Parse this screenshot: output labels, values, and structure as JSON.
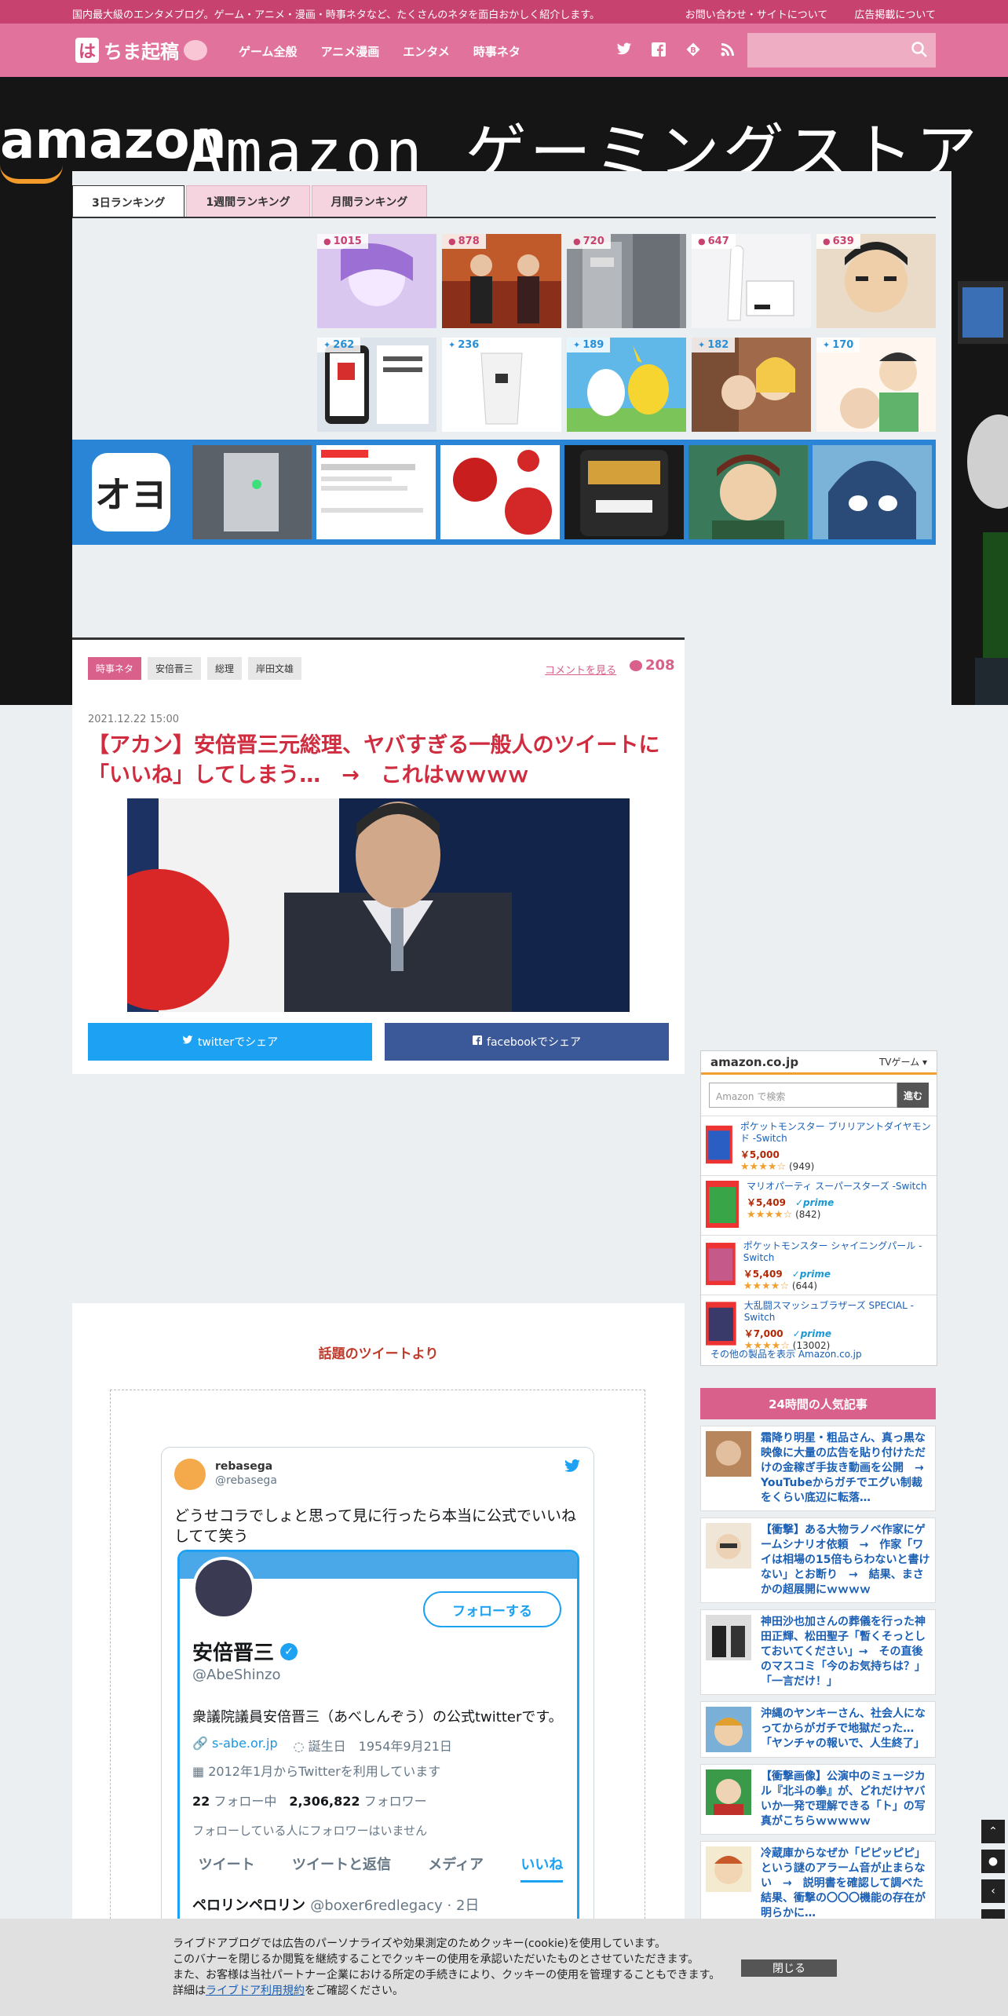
{
  "topbar": {
    "tagline": "国内最大級のエンタメブログ。ゲーム・アニメ・漫画・時事ネタなど、たくさんのネタを面白おかしく紹介します。",
    "contact": "お問い合わせ・サイトについて",
    "ads": "広告掲載について"
  },
  "header": {
    "logo_mark": "は",
    "logo_text": "ちま起稿",
    "menu": [
      "ゲーム全般",
      "アニメ漫画",
      "エンタメ",
      "時事ネタ"
    ]
  },
  "banner": {
    "brand": "amazon",
    "headline": "Amazon ゲーミングストア"
  },
  "ranking": {
    "tabs": [
      "3日ランキング",
      "1週間ランキング",
      "月間ランキング"
    ],
    "comment_counts": [
      "1015",
      "878",
      "720",
      "647",
      "639"
    ],
    "tweet_counts": [
      "262",
      "236",
      "189",
      "182",
      "170"
    ],
    "okuyomu_logo": "オヨ"
  },
  "article": {
    "tags": [
      "時事ネタ",
      "安倍晋三",
      "総理",
      "岸田文雄"
    ],
    "comment_link": "コメントを見る",
    "comment_count": "208",
    "date": "2021.12.22 15:00",
    "title": "【アカン】安倍晋三元総理、ヤバすぎる一般人のツイートに「いいね」してしまう…　→　これはｗｗｗｗ",
    "share_twitter": "twitterでシェア",
    "share_facebook": "facebookでシェア"
  },
  "feature": {
    "heading": "話題のツイートより",
    "tweet": {
      "user": "rebasega",
      "handle": "@rebasega",
      "text": "どうせコラでしょと思って見に行ったら本当に公式でいいねしてて笑う"
    },
    "profile": {
      "follow": "フォローする",
      "name": "安倍晋三",
      "handle": "@AbeShinzo",
      "bio": "衆議院議員安倍晋三（あべしんぞう）の公式twitterです。",
      "link": "s-abe.or.jp",
      "birthday": "誕生日　1954年9月21日",
      "joined": "2012年1月からTwitterを利用しています",
      "following_num": "22",
      "following_label": "フォロー中",
      "followers_num": "2,306,822",
      "followers_label": "フォロワー",
      "no_mutual": "フォローしている人にフォロワーはいません",
      "tabs": [
        "ツイート",
        "ツイートと返信",
        "メディア",
        "いいね"
      ],
      "reply_name": "ペロリンペロリン",
      "reply_handle": "@boxer6redlegacy · 2日"
    }
  },
  "amazon_widget": {
    "logo": "amazon.co.jp",
    "category": "TVゲーム",
    "search_placeholder": "Amazon で検索",
    "search_button": "進む",
    "items": [
      {
        "name": "ポケットモンスター ブリリアントダイヤモンド -Switch",
        "price": "￥5,000",
        "stars": "★★★★☆",
        "reviews": "(949)",
        "prime": ""
      },
      {
        "name": "マリオパーティ スーパースターズ -Switch",
        "price": "￥5,409",
        "stars": "★★★★☆",
        "reviews": "(842)",
        "prime": "✓prime"
      },
      {
        "name": "ポケットモンスター シャイニングパール -Switch",
        "price": "￥5,409",
        "stars": "★★★★☆",
        "reviews": "(644)",
        "prime": "✓prime"
      },
      {
        "name": "大乱闘スマッシュブラザーズ SPECIAL - Switch",
        "price": "￥7,000",
        "stars": "★★★★☆",
        "reviews": "(13002)",
        "prime": "✓prime"
      }
    ],
    "footer": "その他の製品を表示 Amazon.co.jp"
  },
  "popular": {
    "heading": "24時間の人気記事",
    "items": [
      "霜降り明星・粗品さん、真っ黒な映像に大量の広告を貼り付けただけの金稼ぎ手抜き動画を公開　→　YouTubeからガチでエグい制裁をくらい底辺に転落…",
      "【衝撃】ある大物ラノベ作家にゲームシナリオ依頼　→　作家「ワイは相場の15倍もらわないと書けない」とお断り　→　結果、まさかの超展開にｗｗｗｗ",
      "神田沙也加さんの葬儀を行った神田正輝、松田聖子「暫くそっとしておいてください」→　その直後のマスコミ「今のお気持ちは？」「一言だけ！」",
      "沖縄のヤンキーさん、社会人になってからがガチで地獄だった…　「ヤンチャの報いで、人生終了」",
      "【衝撃画像】公演中のミュージカル『北斗の拳』が、どれだけヤバいか一発で理解できる「ト」の写真がこちらｗｗｗｗｗ",
      "冷蔵庫からなぜか「ピピッピピ」という謎のアラーム音が止まらない　→　説明書を確認して調べた結果、衝撃の〇〇〇機能の存在が明らかに…"
    ]
  },
  "cookie": {
    "line1": "ライブドアブログでは広告のパーソナライズや効果測定のためクッキー(cookie)を使用しています。",
    "line2": "このバナーを閉じるか閲覧を継続することでクッキーの使用を承認いただいたものとさせていただきます。",
    "line3": "また、お客様は当社パートナー企業における所定の手続きにより、クッキーの使用を管理することもできます。",
    "line4_pre": "詳細は",
    "line4_link": "ライブドア利用規約",
    "line4_post": "をご確認ください。",
    "close": "閉じる"
  },
  "colors": {
    "brand_pink": "#e0729b",
    "topbar": "#c8426f",
    "title_red": "#cf2c3f",
    "twitter_blue": "#1da1f2",
    "facebook_blue": "#3b5998"
  }
}
